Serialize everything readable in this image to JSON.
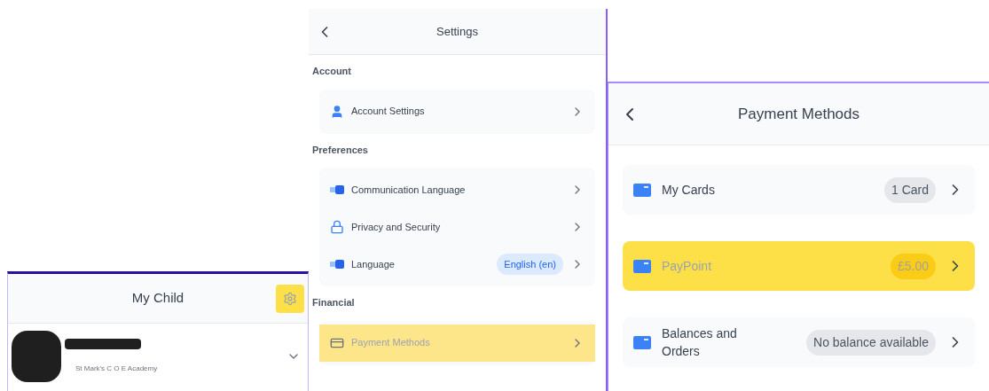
{
  "my_child": {
    "title": "My Child",
    "settings_highlighted": true,
    "school": "St Mark's C O E Academy"
  },
  "settings": {
    "title": "Settings",
    "sections": [
      {
        "heading": "Account",
        "items": [
          {
            "kind": "person",
            "label": "Account Settings",
            "highlighted": false
          }
        ]
      },
      {
        "heading": "Preferences",
        "items": [
          {
            "kind": "language",
            "label": "Communication Language",
            "highlighted": false
          },
          {
            "kind": "lock",
            "label": "Privacy and Security",
            "highlighted": false
          },
          {
            "kind": "language",
            "label": "Language",
            "badge": "English (en)",
            "highlighted": false
          }
        ]
      },
      {
        "heading": "Financial",
        "items": [
          {
            "kind": "card",
            "label": "Payment Methods",
            "highlighted": true
          }
        ]
      }
    ]
  },
  "payment_methods": {
    "title": "Payment Methods",
    "items": [
      {
        "label": "My Cards",
        "badge": "1 Card",
        "highlighted": false
      },
      {
        "label": "PayPoint",
        "badge": "£5.00",
        "highlighted": true
      },
      {
        "label": "Balances and Orders",
        "badge": "No balance available",
        "highlighted": false
      }
    ]
  }
}
